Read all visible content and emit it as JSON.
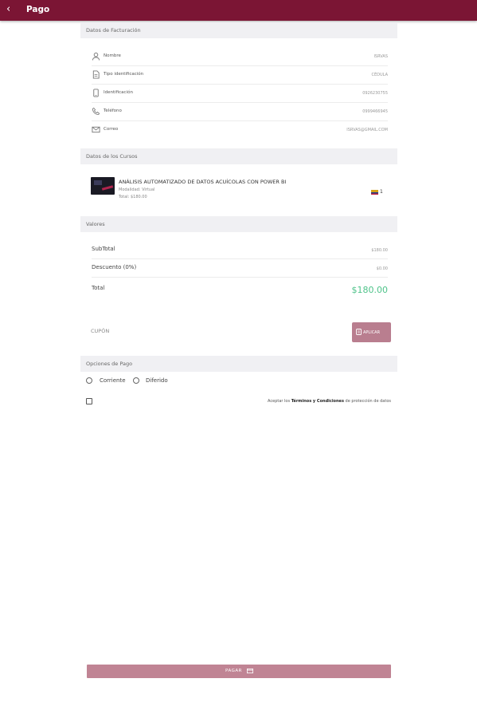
{
  "appbar": {
    "back_icon": "chevron-left-icon",
    "title": "Pago",
    "color": "#7b1534"
  },
  "billing": {
    "header": "Datos de Facturación",
    "rows": [
      {
        "icon": "user-icon",
        "label": "Nombre",
        "value": "ISRVAS"
      },
      {
        "icon": "document-icon",
        "label": "Tipo identificación",
        "value": "CÉDULA"
      },
      {
        "icon": "phone-device-icon",
        "label": "Identificación",
        "value": "0926230755"
      },
      {
        "icon": "phone-icon",
        "label": "Teléfono",
        "value": "0999466945"
      },
      {
        "icon": "mail-icon",
        "label": "Correo",
        "value": "ISRVAS@GMAIL.COM"
      }
    ]
  },
  "courses": {
    "header": "Datos de los Cursos",
    "items": [
      {
        "title": "ANÁLISIS AUTOMATIZADO DE DATOS ACUÍCOLAS CON POWER BI",
        "modality": "Modalidad: Virtual",
        "total": "Total: $180.00",
        "quantity": "1",
        "flag_icon": "ecuador-flag-icon"
      }
    ]
  },
  "values": {
    "header": "Valores",
    "subtotal_label": "SubTotal",
    "subtotal_value": "$180.00",
    "discount_label": "Descuento (0%)",
    "discount_value": "$0.00",
    "total_label": "Total",
    "total_value": "$180.00",
    "total_color": "#4fc38a"
  },
  "coupon": {
    "placeholder": "CUPÓN",
    "apply_label": "APLICAR",
    "apply_icon": "ticket-icon"
  },
  "payment_options": {
    "header": "Opciones de Pago",
    "options": [
      "Corriente",
      "Diferido"
    ]
  },
  "terms": {
    "prefix": "Aceptar los",
    "link": "Términos y Condiciones",
    "suffix": "de protección de datos"
  },
  "pay_button": {
    "label": "PAGAR",
    "icon": "credit-card-icon"
  }
}
